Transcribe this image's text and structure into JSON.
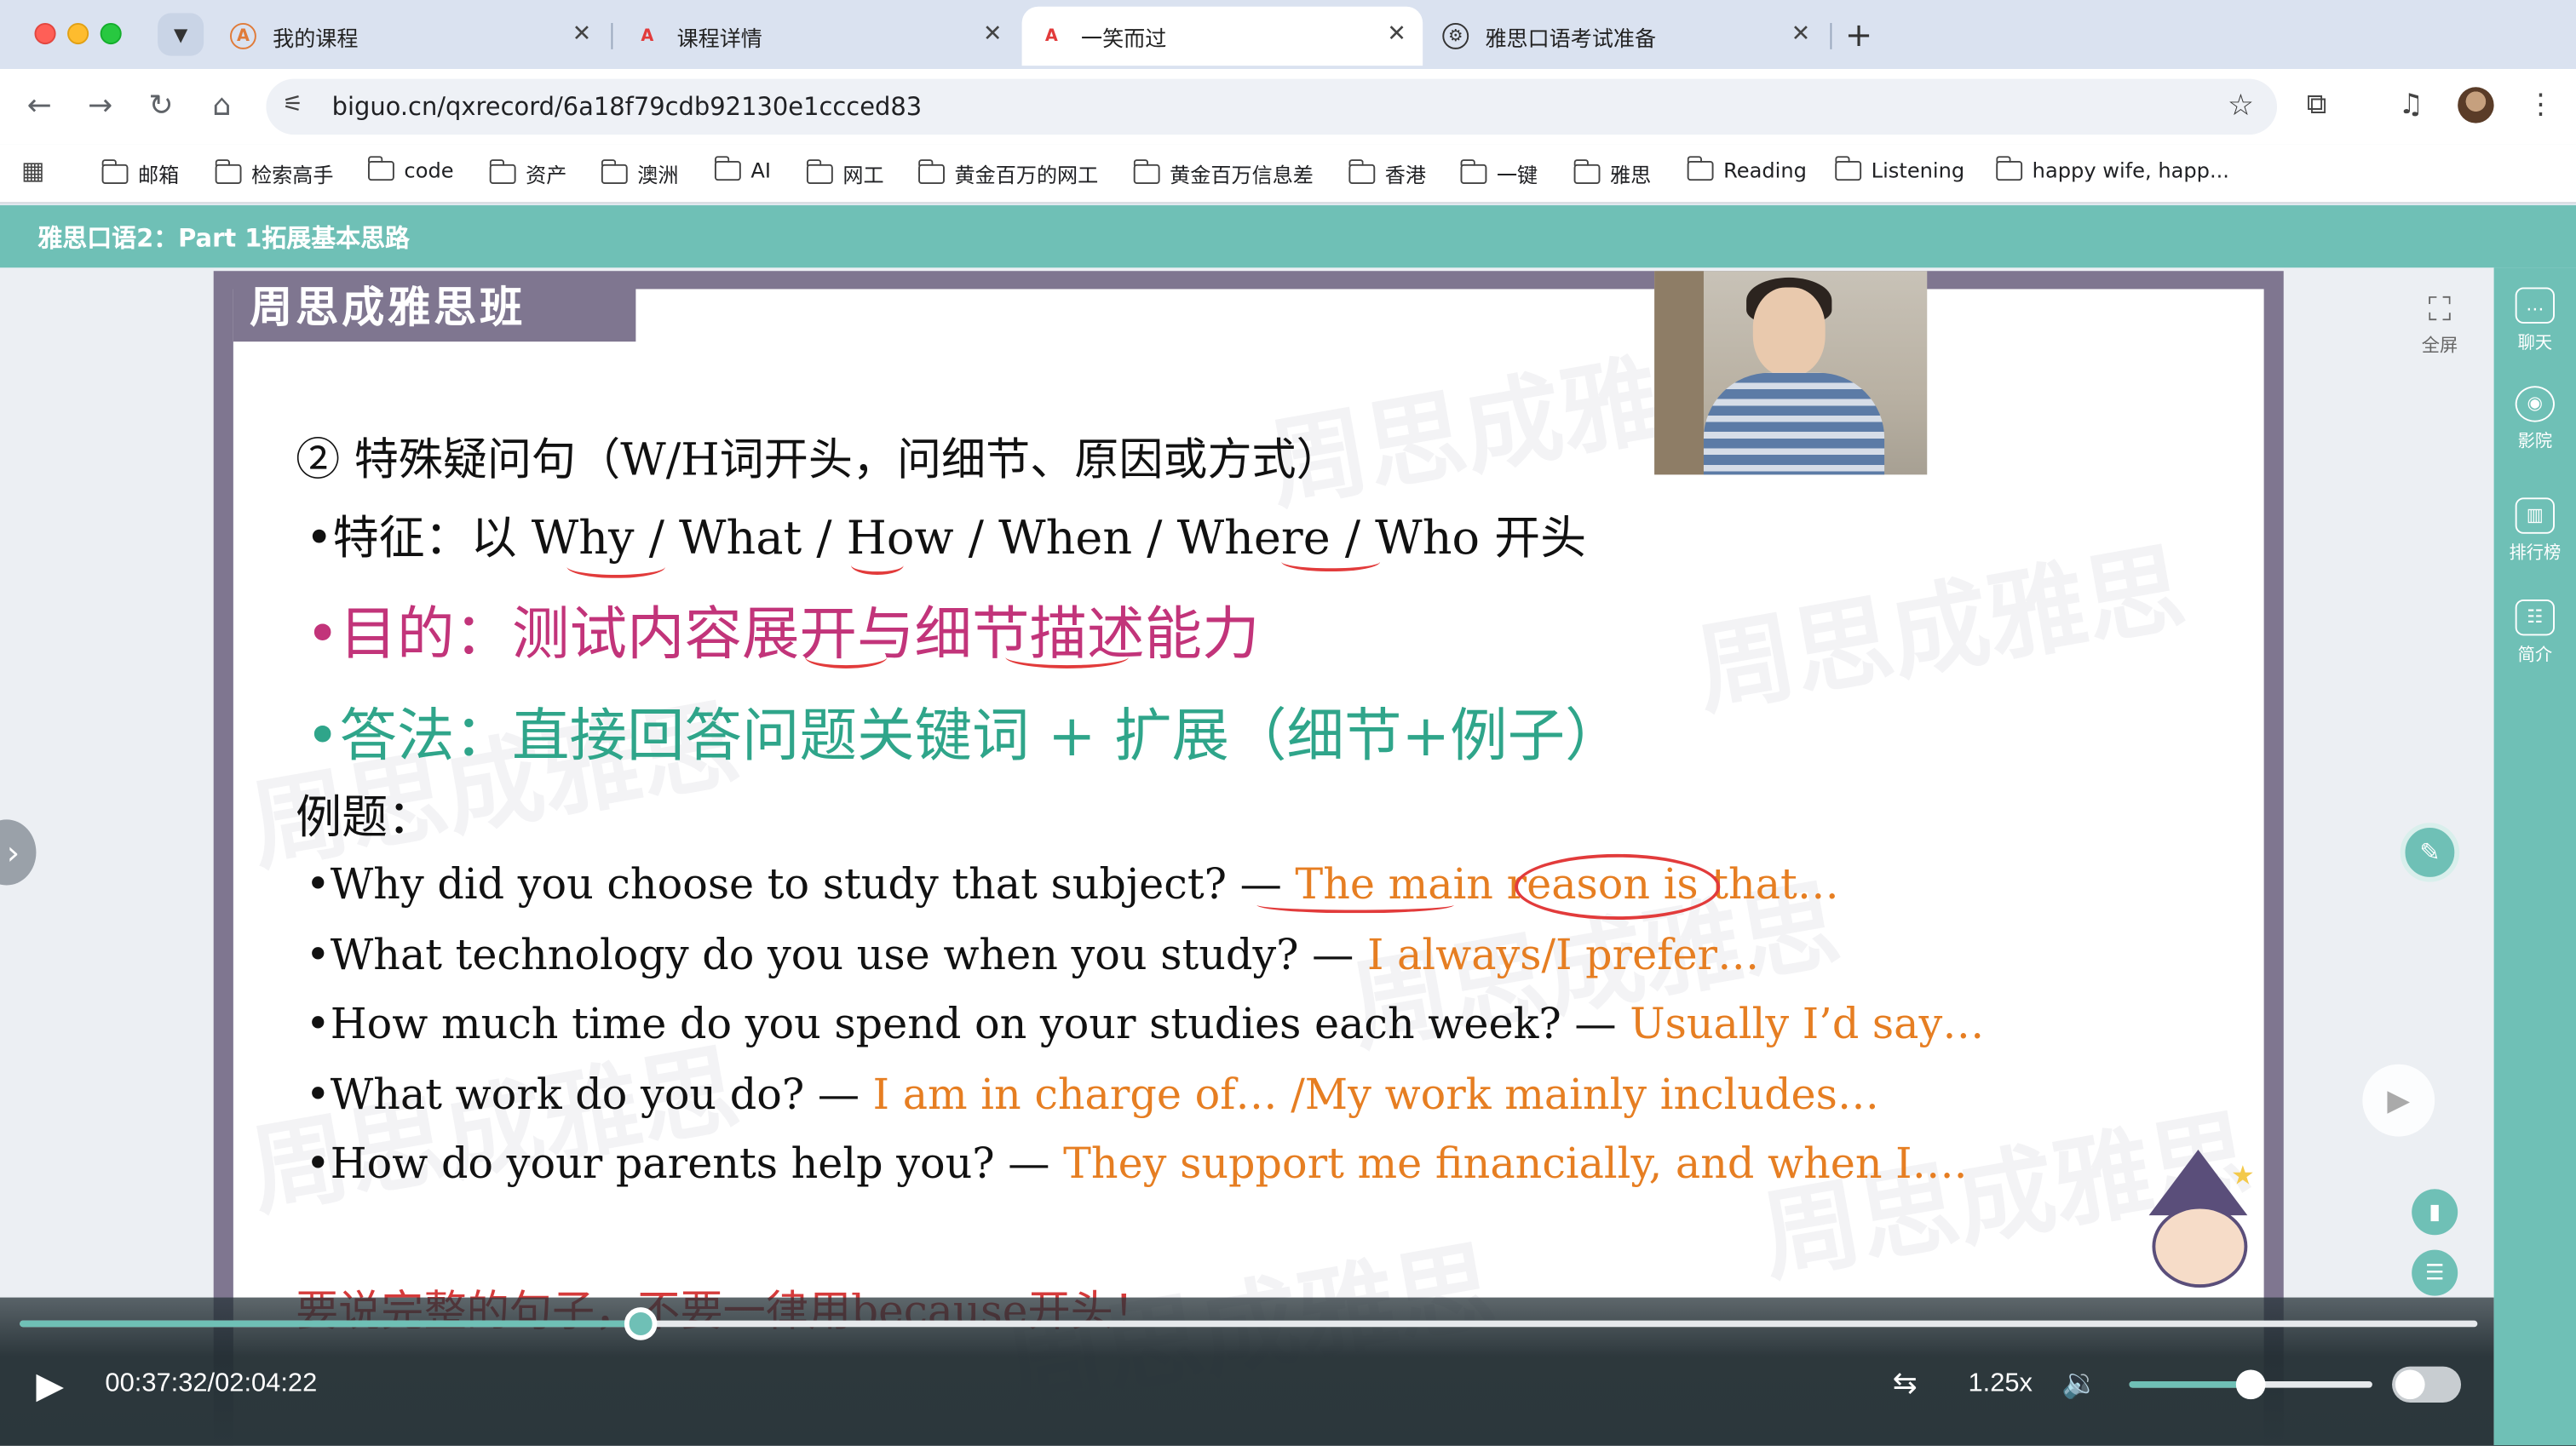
{
  "browser": {
    "tabs": [
      {
        "title": "我的课程",
        "favicon": "course-logo-icon"
      },
      {
        "title": "课程详情",
        "favicon": "course-logo-icon"
      },
      {
        "title": "一笑而过",
        "favicon": "course-logo-icon",
        "active": true
      },
      {
        "title": "雅思口语考试准备",
        "favicon": "chatgpt-icon"
      }
    ],
    "url": "biguo.cn/qxrecord/6a18f79cdb92130e1ccced83",
    "bookmarks": [
      "邮箱",
      "检索高手",
      "code",
      "资产",
      "澳洲",
      "AI",
      "网工",
      "黄金百万的网工",
      "黄金百万信息差",
      "香港",
      "一键",
      "雅思",
      "Reading",
      "Listening",
      "happy wife, happ..."
    ]
  },
  "course": {
    "title": "雅思口语2：Part 1拓展基本思路"
  },
  "slide": {
    "brand": "周思成雅思班",
    "watermark": "周思成雅思",
    "heading": "② 特殊疑问句（W/H词开头，问细节、原因或方式）",
    "feature": "•特征：以 Why / What / How / When / Where / Who 开头",
    "purpose": "•目的：测试内容展开与细节描述能力",
    "answer": "•答法：直接回答问题关键词 + 扩展（细节+例子）",
    "examples_label": "例题：",
    "examples": [
      {
        "q": "•Why did you choose to study that subject?  — ",
        "a": "The main reason is that…"
      },
      {
        "q": "•What technology do you use when you study? — ",
        "a": "I always/I prefer…"
      },
      {
        "q": "•How much time do you spend on your studies each week? — ",
        "a": "Usually I’d say…"
      },
      {
        "q": "•What work do you do? — ",
        "a": "I am in charge of… /My work mainly includes…"
      },
      {
        "q": "•How do your parents help you? — ",
        "a": "They support me financially, and when I…."
      }
    ],
    "bottom_line": "要说完整的句子，不要一律用because开头！"
  },
  "overlay": {
    "fullscreen_label": "全屏"
  },
  "player": {
    "current_time": "00:37:32",
    "total_time": "02:04:22",
    "time_display": "00:37:32/02:04:22",
    "progress": 0.253,
    "speed": "1.25x",
    "volume": 0.5,
    "subtitle_toggle": false
  },
  "rail": {
    "items": [
      {
        "label": "聊天",
        "icon": "chat-icon"
      },
      {
        "label": "影院",
        "icon": "cinema-icon"
      },
      {
        "label": "排行榜",
        "icon": "ranking-icon"
      },
      {
        "label": "简介",
        "icon": "intro-icon"
      }
    ]
  },
  "colors": {
    "accent": "#6fc0b6",
    "purpose_text": "#c2347a",
    "answer_text": "#2fa58a",
    "example_answer": "#e67e22"
  }
}
